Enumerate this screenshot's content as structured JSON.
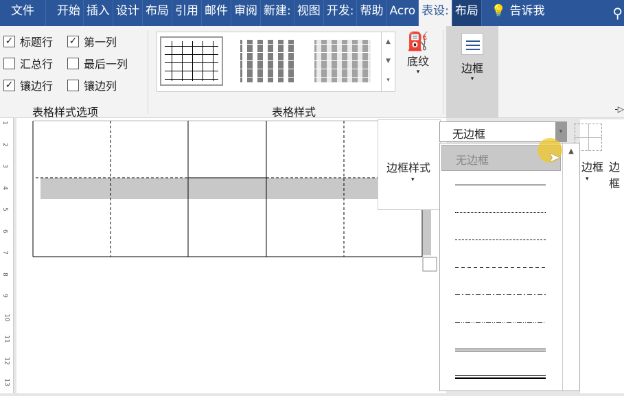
{
  "tabs": [
    "文件",
    "开始",
    "插入",
    "设计",
    "布局",
    "引用",
    "邮件",
    "审阅",
    "新建:",
    "视图",
    "开发:",
    "帮助",
    "Acro",
    "表设:",
    "布局",
    "告诉我"
  ],
  "options": {
    "header_row": "标题行",
    "first_column": "第一列",
    "total_row": "汇总行",
    "last_column": "最后一列",
    "banded_rows": "镶边行",
    "banded_columns": "镶边列",
    "group_label": "表格样式选项"
  },
  "styles": {
    "group_label": "表格样式"
  },
  "shading": "底纹",
  "borders": "边框",
  "border_styles": "边框样式",
  "pen_style": {
    "selected": "无边框",
    "items": [
      "无边框"
    ]
  },
  "right_labels": [
    "边框",
    "边框"
  ],
  "ruler": [
    "1",
    "2",
    "3",
    "4",
    "5",
    "6",
    "7",
    "8",
    "9",
    "10",
    "11",
    "12",
    "13"
  ],
  "colors": {
    "accent": "#2b579a"
  }
}
